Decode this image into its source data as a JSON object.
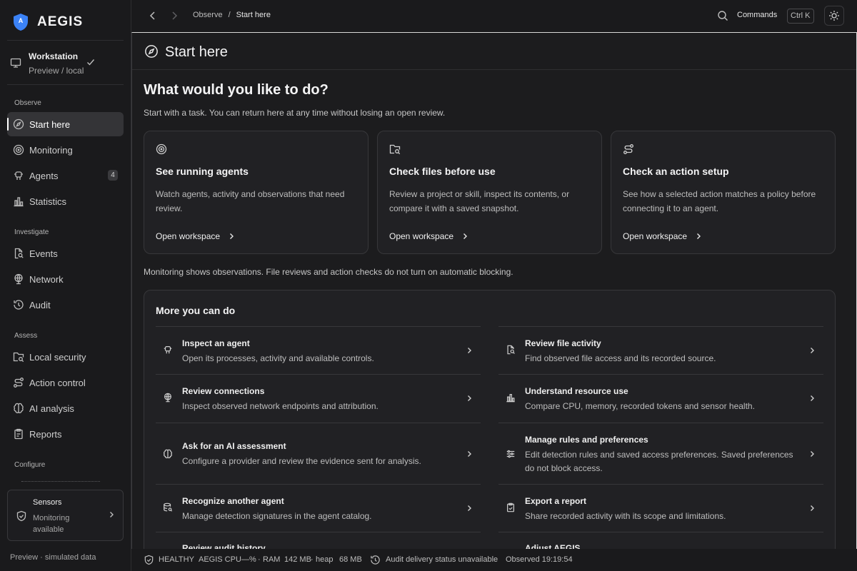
{
  "brand": {
    "logo_letter": "A",
    "name": "AEGIS"
  },
  "workstation": {
    "title": "Workstation",
    "subtitle": "Preview / local"
  },
  "sidebar": {
    "sections": {
      "observe": "Observe",
      "investigate": "Investigate",
      "assess": "Assess",
      "configure": "Configure"
    },
    "items": [
      {
        "label": "Start here",
        "icon": "compass-icon"
      },
      {
        "label": "Monitoring",
        "icon": "radar-icon"
      },
      {
        "label": "Agents",
        "icon": "bot-icon",
        "badge": "4"
      },
      {
        "label": "Statistics",
        "icon": "bar-chart-icon"
      },
      {
        "label": "Events",
        "icon": "file-search-icon"
      },
      {
        "label": "Network",
        "icon": "globe-icon"
      },
      {
        "label": "Audit",
        "icon": "history-icon"
      },
      {
        "label": "Local security",
        "icon": "folder-search-icon"
      },
      {
        "label": "Action control",
        "icon": "route-icon"
      },
      {
        "label": "AI analysis",
        "icon": "brain-icon"
      },
      {
        "label": "Reports",
        "icon": "clipboard-icon"
      }
    ]
  },
  "sensors": {
    "title": "Sensors",
    "status": "Monitoring available"
  },
  "footer": {
    "preview": "Preview · simulated data"
  },
  "topbar": {
    "breadcrumb": {
      "parent": "Observe",
      "separator": "/",
      "current": "Start here"
    },
    "commands_label": "Commands",
    "shortcut": "Ctrl K"
  },
  "page": {
    "title": "Start here",
    "question": "What would you like to do?",
    "subtitle": "Start with a task. You can return here at any time without losing an open review.",
    "note": "Monitoring shows observations. File reviews and action checks do not turn on automatic blocking."
  },
  "cards": [
    {
      "title": "See running agents",
      "desc": "Watch agents, activity and observations that need review.",
      "link": "Open workspace",
      "icon": "radar-icon"
    },
    {
      "title": "Check files before use",
      "desc": "Review a project or skill, inspect its contents, or compare it with a saved snapshot.",
      "link": "Open workspace",
      "icon": "folder-search-icon"
    },
    {
      "title": "Check an action setup",
      "desc": "See how a selected action matches a policy before connecting it to an agent.",
      "link": "Open workspace",
      "icon": "route-icon"
    }
  ],
  "more": {
    "title": "More you can do",
    "items": [
      {
        "title": "Inspect an agent",
        "desc": "Open its processes, activity and available controls.",
        "icon": "bot-icon"
      },
      {
        "title": "Review file activity",
        "desc": "Find observed file access and its recorded source.",
        "icon": "file-search-icon"
      },
      {
        "title": "Review connections",
        "desc": "Inspect observed network endpoints and attribution.",
        "icon": "globe-icon"
      },
      {
        "title": "Understand resource use",
        "desc": "Compare CPU, memory, recorded tokens and sensor health.",
        "icon": "bar-chart-icon"
      },
      {
        "title": "Ask for an AI assessment",
        "desc": "Configure a provider and review the evidence sent for analysis.",
        "icon": "brain-icon"
      },
      {
        "title": "Manage rules and preferences",
        "desc": "Edit detection rules and saved access preferences. Saved preferences do not block access.",
        "icon": "sliders-icon"
      },
      {
        "title": "Recognize another agent",
        "desc": "Manage detection signatures in the agent catalog.",
        "icon": "database-search-icon"
      },
      {
        "title": "Export a report",
        "desc": "Share recorded activity with its scope and limitations.",
        "icon": "clipboard-icon"
      },
      {
        "title": "Review audit history",
        "desc": "",
        "icon": "history-icon"
      },
      {
        "title": "Adjust AEGIS",
        "desc": "",
        "icon": "gear-icon"
      }
    ]
  },
  "status": {
    "health": "HEALTHY",
    "cpu_label": "AEGIS CPU",
    "cpu_value": "—%",
    "sep": "·",
    "ram_label": "RAM",
    "ram_value": "142 MB",
    "heap_label": "heap",
    "heap_value": "68 MB",
    "audit": "Audit delivery status unavailable",
    "observed": "Observed 19:19:54"
  },
  "colors": {
    "brand_blue": "#3b82f6",
    "background": "#1c1c1e",
    "sidebar": "#1a1a1c",
    "card": "#212124",
    "active": "#343437"
  }
}
